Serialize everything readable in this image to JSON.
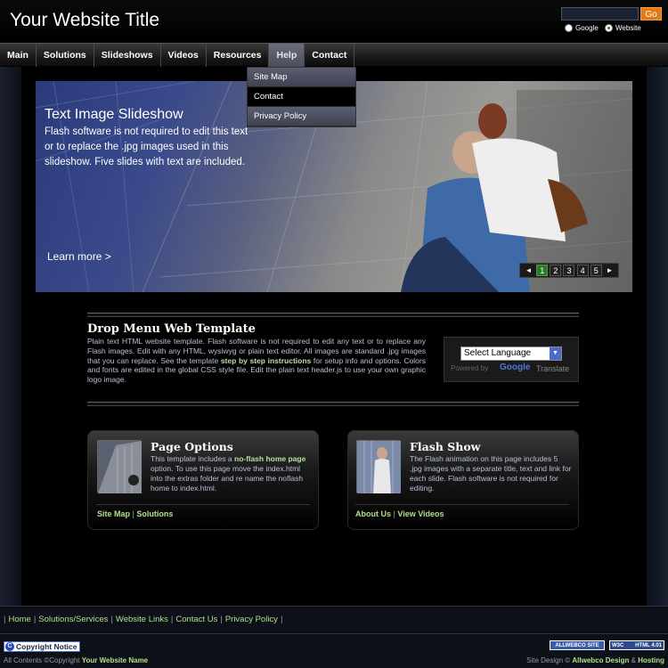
{
  "header": {
    "site_title": "Your Website Title",
    "search": {
      "value": "",
      "go_label": "Go"
    },
    "radio_google": "Google",
    "radio_website": "Website"
  },
  "nav": {
    "items": [
      "Main",
      "Solutions",
      "Slideshows",
      "Videos",
      "Resources",
      "Help",
      "Contact"
    ],
    "active": "Help"
  },
  "dropdown": {
    "items": [
      "Site Map",
      "Contact",
      "Privacy Policy"
    ],
    "hovered": "Contact"
  },
  "slideshow": {
    "title": "Text Image Slideshow",
    "text": "Flash software is not required to edit this text or to replace the .jpg images used in this slideshow. Five slides with text are included.",
    "learn_more": "Learn more >",
    "pager": {
      "prev": "◄",
      "pages": [
        "1",
        "2",
        "3",
        "4",
        "5"
      ],
      "active": "1",
      "next": "►"
    }
  },
  "main": {
    "heading": "Drop Menu Web Template",
    "text_before": "Plain text HTML website template. Flash software is not required to edit any text or to replace any Flash images. Edit with any HTML, wysiwyg or plain text editor. All images are standard .jpg images that you can replace. See the template ",
    "text_link": "step by step instructions",
    "text_after": " for setup info and options. Colors and fonts are edited in the global CSS style file. Edit the plain text header.js to use your own graphic logo image."
  },
  "translate": {
    "select_label": "Select Language",
    "powered_by": "Powered by",
    "google": "Google",
    "translate_label": "Translate"
  },
  "cards": [
    {
      "title": "Page Options",
      "text_before": "This template includes a ",
      "text_link": "no-flash home page",
      "text_after": " option. To use this page move the index.html into the extras folder and re name the noflash home to index.html.",
      "link_1": "Site Map",
      "link_2": "Solutions"
    },
    {
      "title": "Flash Show",
      "text": "The Flash animation on this page includes 5 .jpg images with a separate title, text and link for each slide. Flash software is not required for editing.",
      "link_1": "About Us",
      "link_2": "View Videos"
    }
  ],
  "footer": {
    "links": [
      "Home",
      "Solutions/Services",
      "Website Links",
      "Contact Us",
      "Privacy Policy"
    ],
    "copyright_notice": "Copyright Notice",
    "all_contents_prefix": "All Contents ©Copyright",
    "all_contents_name": "Your Website Name",
    "badge_allwebco": "ALLWEBCO SITE",
    "badge_w3c": "W3C",
    "badge_html": "HTML 4.01",
    "site_design_prefix": "Site Design ©",
    "site_design_name": "Allwebco Design",
    "site_design_amp": "&",
    "site_design_hosting": "Hosting"
  },
  "colors": {
    "accent_orange": "#e07b1a",
    "link_green": "#aee08a",
    "active_page_green": "#2a7a2a"
  }
}
